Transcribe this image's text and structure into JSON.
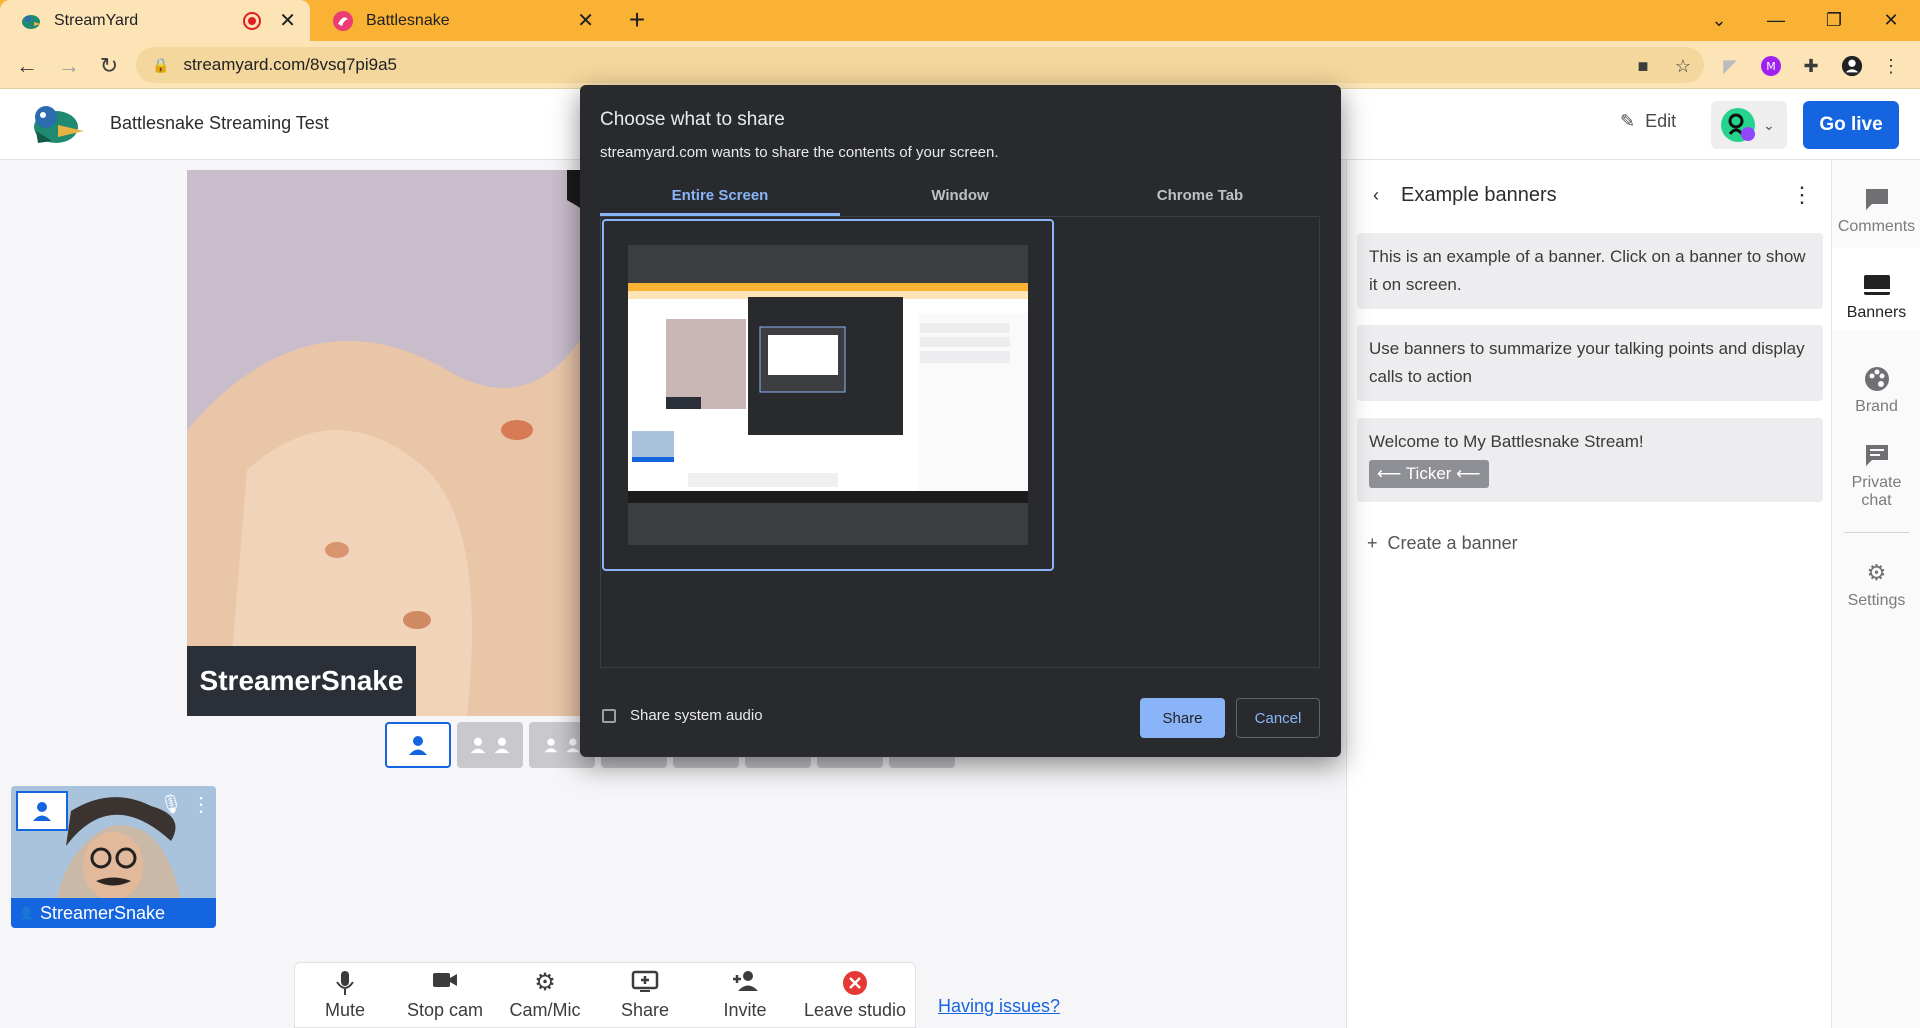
{
  "browser": {
    "tabs": [
      {
        "title": "StreamYard",
        "recording": true
      },
      {
        "title": "Battlesnake",
        "recording": false
      }
    ],
    "url": "streamyard.com/8vsq7pi9a5"
  },
  "header": {
    "studio_title": "Battlesnake Streaming Test",
    "edit_label": "Edit",
    "go_live_label": "Go live"
  },
  "stage": {
    "name_tag": "StreamerSnake"
  },
  "guest": {
    "name": "StreamerSnake"
  },
  "controls": [
    {
      "label": "Mute",
      "icon": "mic-icon"
    },
    {
      "label": "Stop cam",
      "icon": "camera-icon"
    },
    {
      "label": "Cam/Mic",
      "icon": "gear-icon"
    },
    {
      "label": "Share",
      "icon": "share-screen-icon"
    },
    {
      "label": "Invite",
      "icon": "invite-icon"
    },
    {
      "label": "Leave studio",
      "icon": "leave-icon",
      "color": "#e53935"
    }
  ],
  "having_issues": "Having issues?",
  "banners_panel": {
    "title": "Example banners",
    "banners": [
      "This is an example of a banner. Click on a banner to show it on screen.",
      "Use banners to summarize your talking points and display calls to action",
      "Welcome to My Battlesnake Stream!"
    ],
    "ticker_label": "⟵ Ticker ⟵",
    "create_label": "Create a banner"
  },
  "rail": [
    {
      "label": "Comments",
      "icon": "comment-icon"
    },
    {
      "label": "Banners",
      "icon": "banner-icon",
      "active": true
    },
    {
      "label": "Brand",
      "icon": "palette-icon"
    },
    {
      "label": "Private chat",
      "icon": "chat-icon"
    },
    {
      "label": "Settings",
      "icon": "gear-icon"
    }
  ],
  "share_dialog": {
    "title": "Choose what to share",
    "subtitle": "streamyard.com wants to share the contents of your screen.",
    "tabs": [
      "Entire Screen",
      "Window",
      "Chrome Tab"
    ],
    "active_tab": "Entire Screen",
    "audio_checkbox_label": "Share system audio",
    "audio_checked": false,
    "share_label": "Share",
    "cancel_label": "Cancel"
  },
  "colors": {
    "accent": "#1565e0",
    "tab_strip": "#f9b233",
    "dialog_bg": "#292a2d",
    "dialog_accent": "#8ab4f8"
  }
}
